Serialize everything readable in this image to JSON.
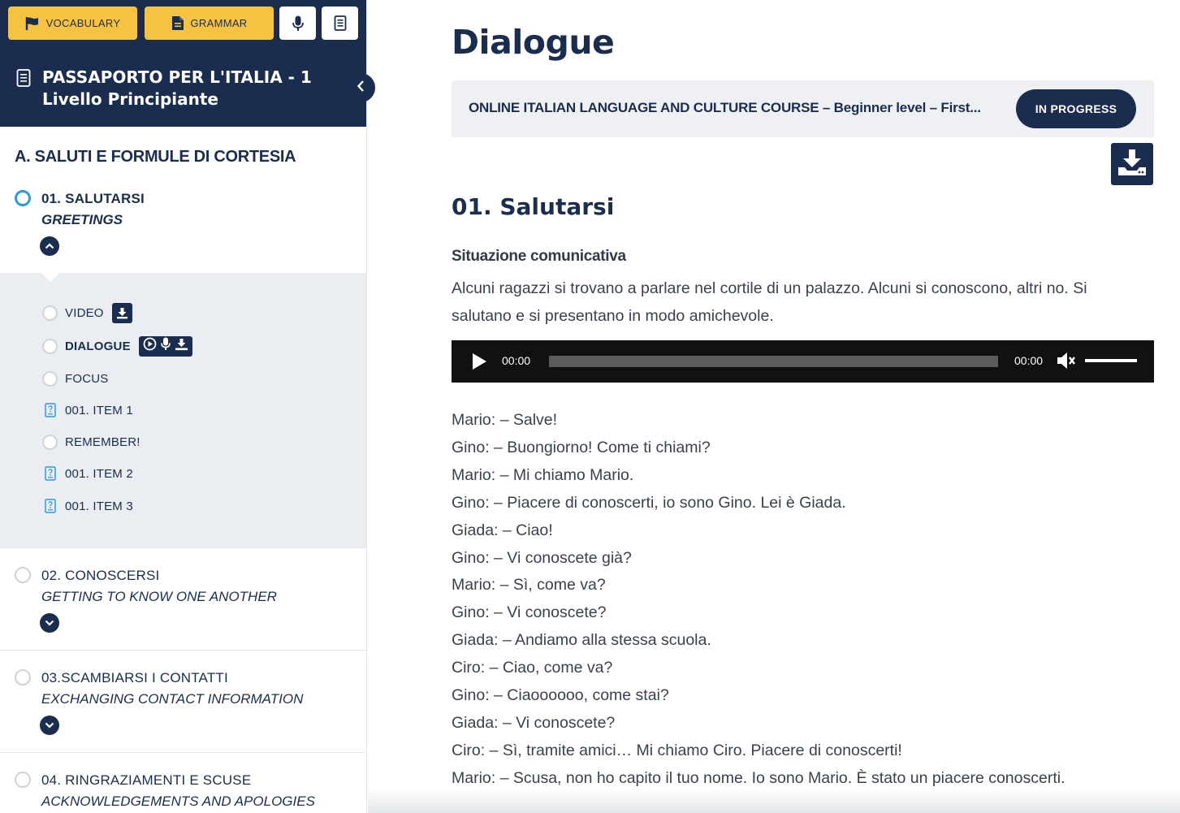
{
  "toolbar": {
    "vocabulary_label": "VOCABULARY",
    "grammar_label": "GRAMMAR",
    "vocabulary_icon": "flag-icon",
    "grammar_icon": "file-icon",
    "mic_icon": "microphone-icon",
    "notes_icon": "notes-icon"
  },
  "course": {
    "title_line1": "PASSAPORTO PER L'ITALIA - 1",
    "title_line2": "Livello Principiante"
  },
  "sidebar": {
    "section_title": "A. SALUTI E FORMULE DI CORTESIA",
    "lessons": [
      {
        "title": "01. SALUTARSI",
        "subtitle": "GREETINGS",
        "active": true,
        "expanded": true
      },
      {
        "title": "02. CONOSCERSI",
        "subtitle": "GETTING TO KNOW ONE ANOTHER",
        "active": false,
        "expanded": false
      },
      {
        "title": "03.SCAMBIARSI I CONTATTI",
        "subtitle": "EXCHANGING CONTACT INFORMATION",
        "active": false,
        "expanded": false
      },
      {
        "title": "04. RINGRAZIAMENTI E SCUSE",
        "subtitle": "ACKNOWLEDGEMENTS AND APOLOGIES",
        "active": false,
        "expanded": false
      }
    ],
    "sub_items": [
      {
        "label": "VIDEO",
        "icon": "circle"
      },
      {
        "label": "DIALOGUE",
        "icon": "circle",
        "current": true
      },
      {
        "label": "FOCUS",
        "icon": "circle"
      },
      {
        "label": "001. ITEM 1",
        "icon": "quiz-doc-icon"
      },
      {
        "label": "REMEMBER!",
        "icon": "circle"
      },
      {
        "label": "001. ITEM 2",
        "icon": "quiz-doc-icon"
      },
      {
        "label": "001. ITEM 3",
        "icon": "quiz-doc-icon"
      }
    ]
  },
  "main": {
    "page_title": "Dialogue",
    "course_bar_text": "ONLINE ITALIAN LANGUAGE AND CULTURE COURSE – Beginner level – First...",
    "status": "IN PROGRESS",
    "lesson_title": "01. Salutarsi",
    "situation_heading": "Situazione comunicativa",
    "situation_text": "Alcuni ragazzi si trovano a parlare nel cortile di un palazzo. Alcuni si conoscono, altri no. Si salutano e si presentano in modo amichevole.",
    "player": {
      "current_time": "00:00",
      "duration": "00:00",
      "progress": 0,
      "volume": 1
    },
    "dialogue": [
      "Mario: – Salve!",
      "Gino: – Buongiorno! Come ti chiami?",
      "Mario: – Mi chiamo Mario.",
      "Gino: – Piacere di conoscerti, io sono Gino. Lei è Giada.",
      "Giada: – Ciao!",
      "Gino: – Vi conoscete già?",
      "Mario: – Sì, come va?",
      "Gino: – Vi conoscete?",
      "Giada: – Andiamo alla stessa scuola.",
      "Ciro: – Ciao, come va?",
      "Gino: – Ciaoooooo, come stai?",
      "Giada: – Vi conoscete?",
      "Ciro: – Sì, tramite amici… Mi chiamo Ciro. Piacere di conoscerti!",
      "Mario: – Scusa, non ho capito il tuo nome. Io sono Mario. È stato un piacere conoscerti."
    ]
  },
  "colors": {
    "navy": "#1b2d4f",
    "accent_yellow": "#f5c242",
    "active_blue": "#2e9ad8",
    "panel_gray": "#eaeef3"
  }
}
